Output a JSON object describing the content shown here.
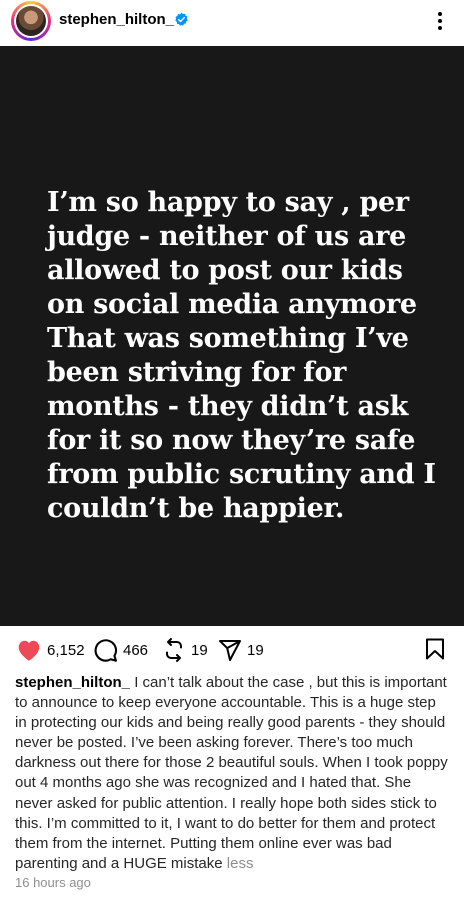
{
  "post": {
    "username": "stephen_hilton_",
    "image_text": "I’m so happy to say , per judge - neither of us are allowed to post our kids on social media anymore That was something I’ve been striving for for months - they didn’t ask for it so now they’re safe from public scrutiny and I couldn’t be happier.",
    "likes": "6,152",
    "comments": "466",
    "reposts": "19",
    "shares": "19",
    "caption": "I can’t talk about the case , but this is important to announce to keep everyone accountable. This is a huge step in protecting our kids and being really good parents - they should never be posted. I’ve been asking forever. There’s too much darkness out there for those 2 beautiful souls. When I took poppy out 4 months ago she was recognized and I hated that. She never asked for public attention. I really hope both sides stick to this. I’m committed to it, I want to do better for them and protect them from the internet. Putting them online ever was bad parenting and a HUGE mistake",
    "less_label": "less",
    "timestamp": "16 hours ago"
  },
  "colors": {
    "like": "#ed4956",
    "verified": "#0095f6",
    "image_bg": "#181818",
    "secondary_text": "#8e8e8e"
  },
  "icons": [
    "more-icon",
    "verified-icon",
    "heart-icon",
    "comment-icon",
    "repost-icon",
    "share-icon",
    "bookmark-icon"
  ]
}
